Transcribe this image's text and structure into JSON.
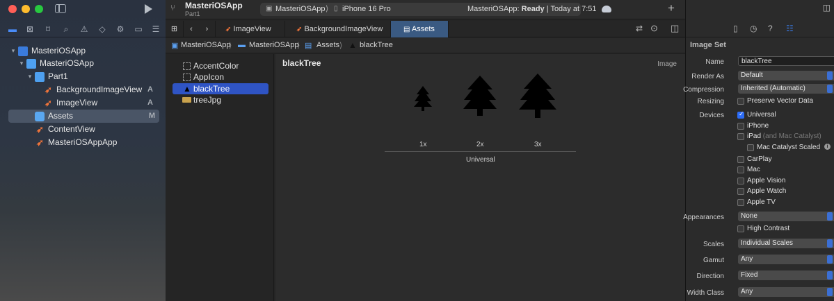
{
  "project": {
    "name": "MasteriOSApp",
    "subtitle": "Part1"
  },
  "toolbar": {
    "scheme": "MasteriOSApp",
    "device": "iPhone 16 Pro",
    "status_prefix": "MasteriOSApp: ",
    "status_ready": "Ready",
    "status_suffix": " | Today at 7:51",
    "add": "+"
  },
  "navigator": {
    "items": [
      {
        "label": "MasteriOSApp",
        "badge": ""
      },
      {
        "label": "MasteriOSApp",
        "badge": ""
      },
      {
        "label": "Part1",
        "badge": ""
      },
      {
        "label": "BackgroundImageView",
        "badge": "A"
      },
      {
        "label": "ImageView",
        "badge": "A"
      },
      {
        "label": "Assets",
        "badge": "M"
      },
      {
        "label": "ContentView",
        "badge": ""
      },
      {
        "label": "MasteriOSAppApp",
        "badge": ""
      }
    ]
  },
  "tabs": [
    {
      "label": "ImageView"
    },
    {
      "label": "BackgroundImageView"
    },
    {
      "label": "Assets"
    }
  ],
  "jumpbar": [
    "MasteriOSApp",
    "MasteriOSApp",
    "Assets",
    "blackTree"
  ],
  "assets": [
    "AccentColor",
    "AppIcon",
    "blackTree",
    "treeJpg"
  ],
  "editor": {
    "title": "blackTree",
    "type_label": "Image",
    "slots": [
      "1x",
      "2x",
      "3x"
    ],
    "group_label": "Universal"
  },
  "inspector": {
    "section": "Image Set",
    "name_label": "Name",
    "name_value": "blackTree",
    "render_label": "Render As",
    "render_value": "Default",
    "compression_label": "Compression",
    "compression_value": "Inherited (Automatic)",
    "resizing_label": "Resizing",
    "resizing_value": "Preserve Vector Data",
    "devices_label": "Devices",
    "devices": [
      "Universal",
      "iPhone",
      "iPad",
      "Mac Catalyst Scaled",
      "CarPlay",
      "Mac",
      "Apple Vision",
      "Apple Watch",
      "Apple TV"
    ],
    "ipad_note": "(and Mac Catalyst)",
    "appearances_label": "Appearances",
    "appearances_value": "None",
    "high_contrast": "High Contrast",
    "scales_label": "Scales",
    "scales_value": "Individual Scales",
    "gamut_label": "Gamut",
    "gamut_value": "Any",
    "direction_label": "Direction",
    "direction_value": "Fixed",
    "width_label": "Width Class",
    "width_value": "Any"
  }
}
